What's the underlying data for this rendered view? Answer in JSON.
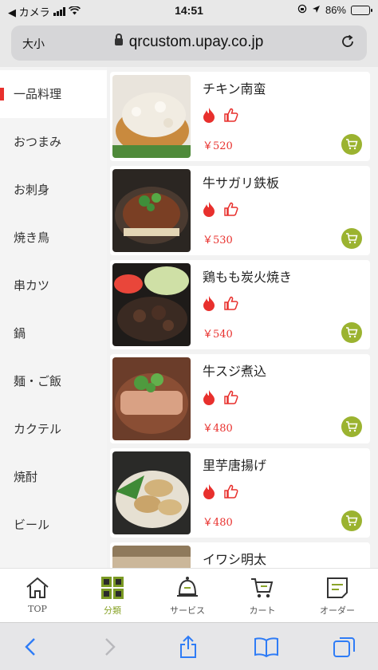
{
  "status_bar": {
    "carrier": "◀ カメラ",
    "time": "14:51",
    "battery": "86%",
    "battery_level": 0.86
  },
  "browser": {
    "text_size_label": "大小",
    "url": "qrcustom.upay.co.jp"
  },
  "categories": [
    {
      "label": "一品料理",
      "active": true
    },
    {
      "label": "おつまみ"
    },
    {
      "label": "お刺身"
    },
    {
      "label": "焼き鳥"
    },
    {
      "label": "串カツ"
    },
    {
      "label": "鍋"
    },
    {
      "label": "麺・ご飯"
    },
    {
      "label": "カクテル"
    },
    {
      "label": "焼酎"
    },
    {
      "label": "ビール"
    }
  ],
  "products": [
    {
      "name": "チキン南蛮",
      "price": "￥520"
    },
    {
      "name": "牛サガリ鉄板",
      "price": "￥530"
    },
    {
      "name": "鶏もも炭火焼き",
      "price": "￥540"
    },
    {
      "name": "牛スジ煮込",
      "price": "￥480"
    },
    {
      "name": "里芋唐揚げ",
      "price": "￥480"
    },
    {
      "name": "イワシ明太",
      "price": ""
    }
  ],
  "bottom_nav": [
    {
      "label": "TOP",
      "icon": "home-icon"
    },
    {
      "label": "分類",
      "icon": "grid-icon",
      "active": true
    },
    {
      "label": "サービス",
      "icon": "bell-icon"
    },
    {
      "label": "カート",
      "icon": "cart-icon"
    },
    {
      "label": "オーダー",
      "icon": "order-icon"
    }
  ],
  "colors": {
    "accent_red": "#e8302d",
    "accent_green": "#9bb330",
    "safari_blue": "#2f7cf6"
  }
}
